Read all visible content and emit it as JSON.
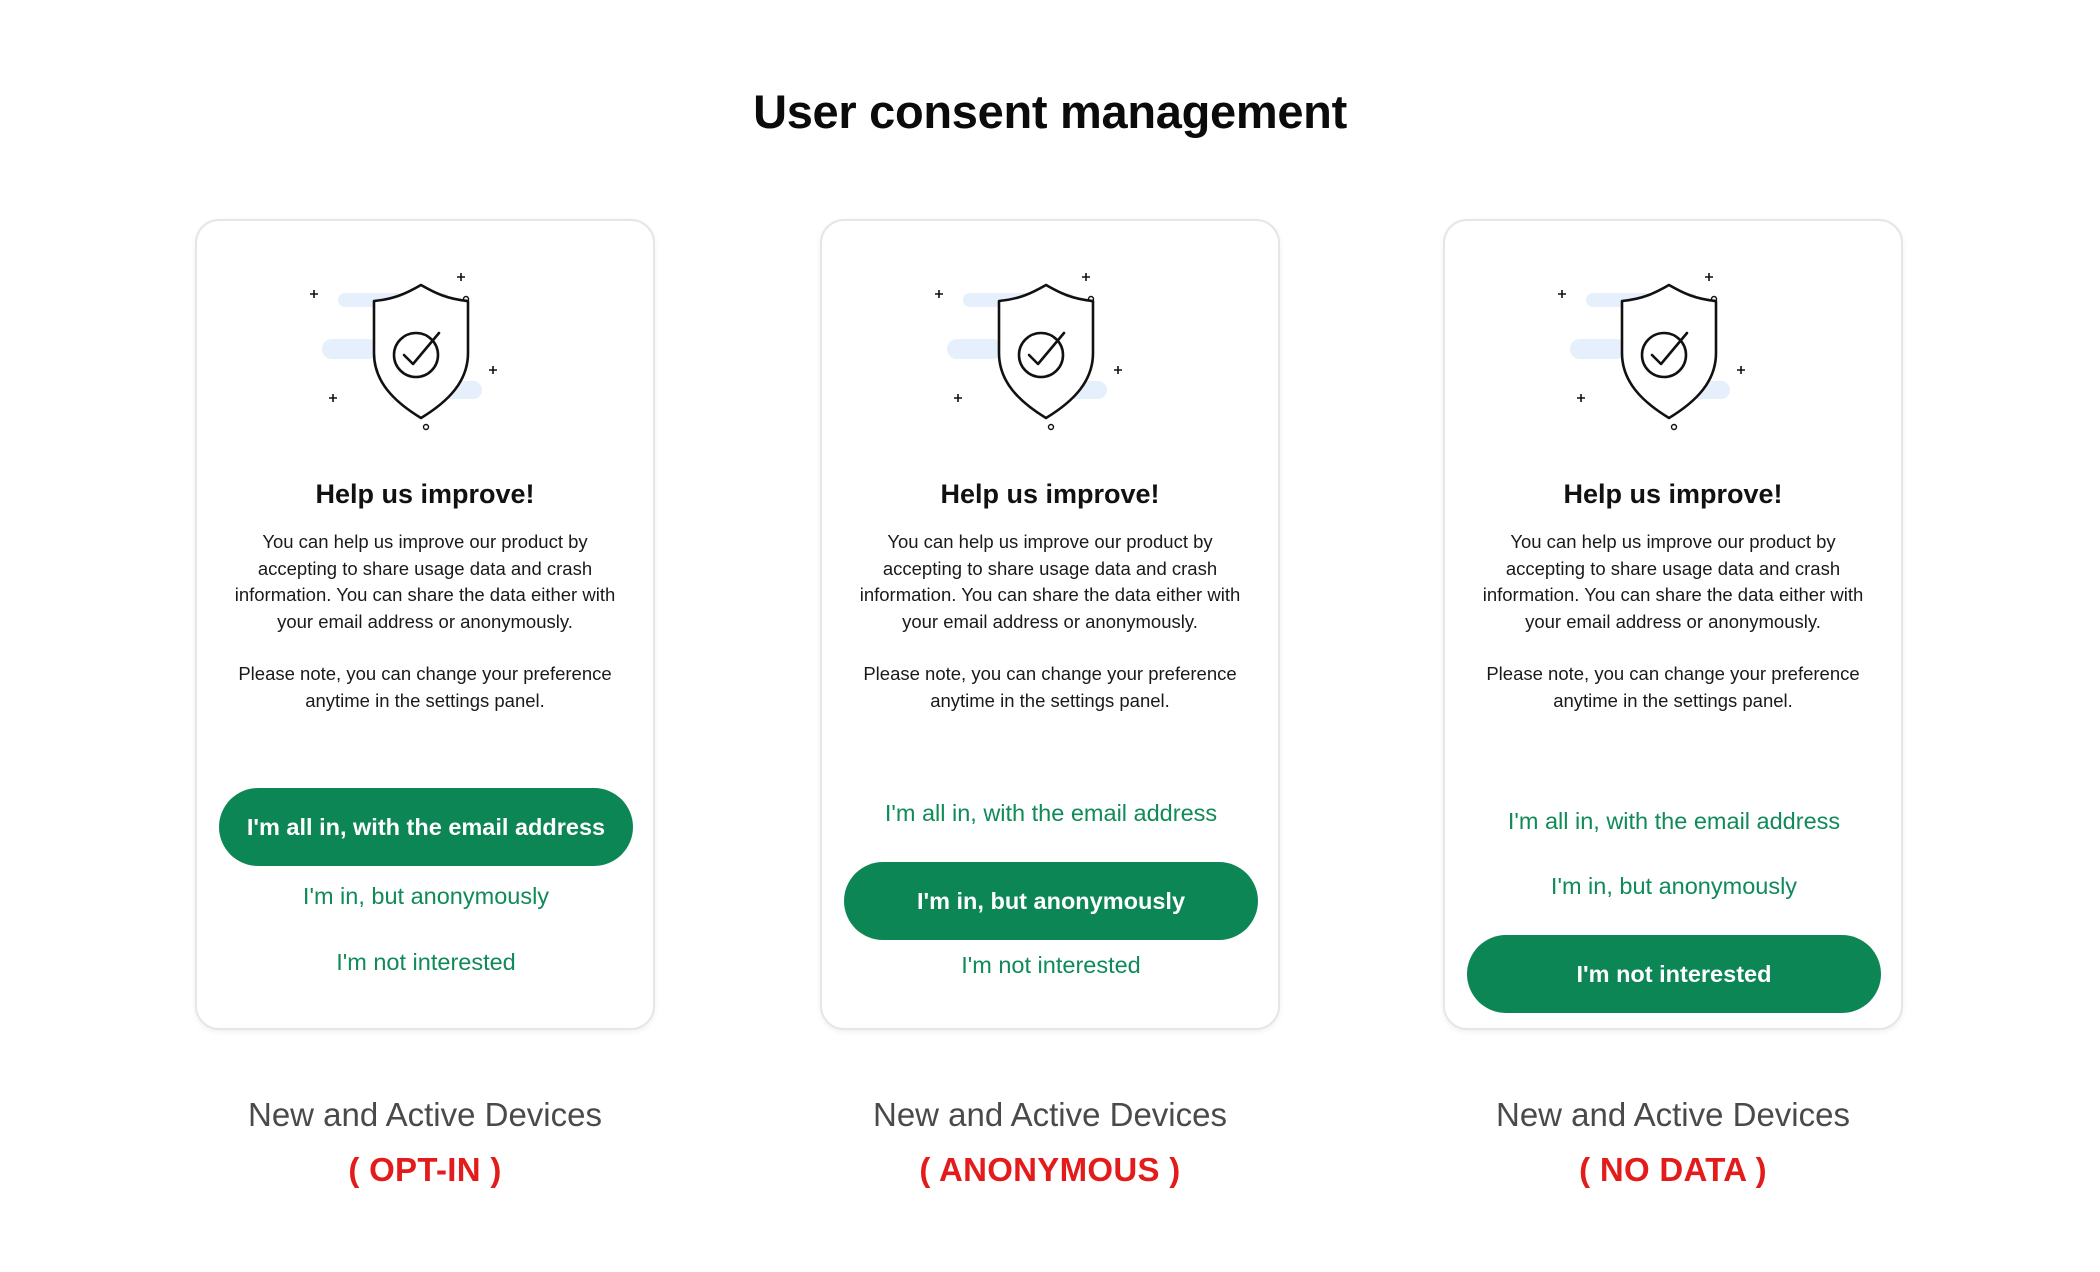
{
  "page": {
    "title": "User consent management"
  },
  "colors": {
    "accent_green": "#0d8655",
    "status_red": "#e31b1b",
    "illustration_blue": "#e6effc"
  },
  "icons": {
    "illustration": "shield-check-icon"
  },
  "cards": [
    {
      "heading": "Help us improve!",
      "body": "You can help us improve our product by accepting to share usage data and crash information. You can share the data either with your email address or anonymously.",
      "note": "Please note, you can change your preference anytime in the settings panel.",
      "options": [
        {
          "label": "I'm all in, with the email address"
        },
        {
          "label": "I'm in, but anonymously"
        },
        {
          "label": "I'm not interested"
        }
      ],
      "selected_option": "I'm all in, with the email address",
      "caption": "New and Active Devices",
      "status": "( OPT-IN )"
    },
    {
      "heading": "Help us improve!",
      "body": "You can help us improve our product by accepting to share usage data and crash information. You can share the data either with your email address or anonymously.",
      "note": "Please note, you can change your preference anytime in the settings panel.",
      "options": [
        {
          "label": "I'm all in, with the email address"
        },
        {
          "label": "I'm in, but anonymously"
        },
        {
          "label": "I'm not interested"
        }
      ],
      "selected_option": "I'm in, but anonymously",
      "caption": "New and Active Devices",
      "status": "( ANONYMOUS )"
    },
    {
      "heading": "Help us improve!",
      "body": "You can help us improve our product by accepting to share usage data and crash information. You can share the data either with your email address or anonymously.",
      "note": "Please note, you can change your preference anytime in the settings panel.",
      "options": [
        {
          "label": "I'm all in, with the email address"
        },
        {
          "label": "I'm in, but anonymously"
        },
        {
          "label": "I'm not interested"
        }
      ],
      "selected_option": "I'm not interested",
      "caption": "New and Active Devices",
      "status": "( NO DATA )"
    }
  ]
}
